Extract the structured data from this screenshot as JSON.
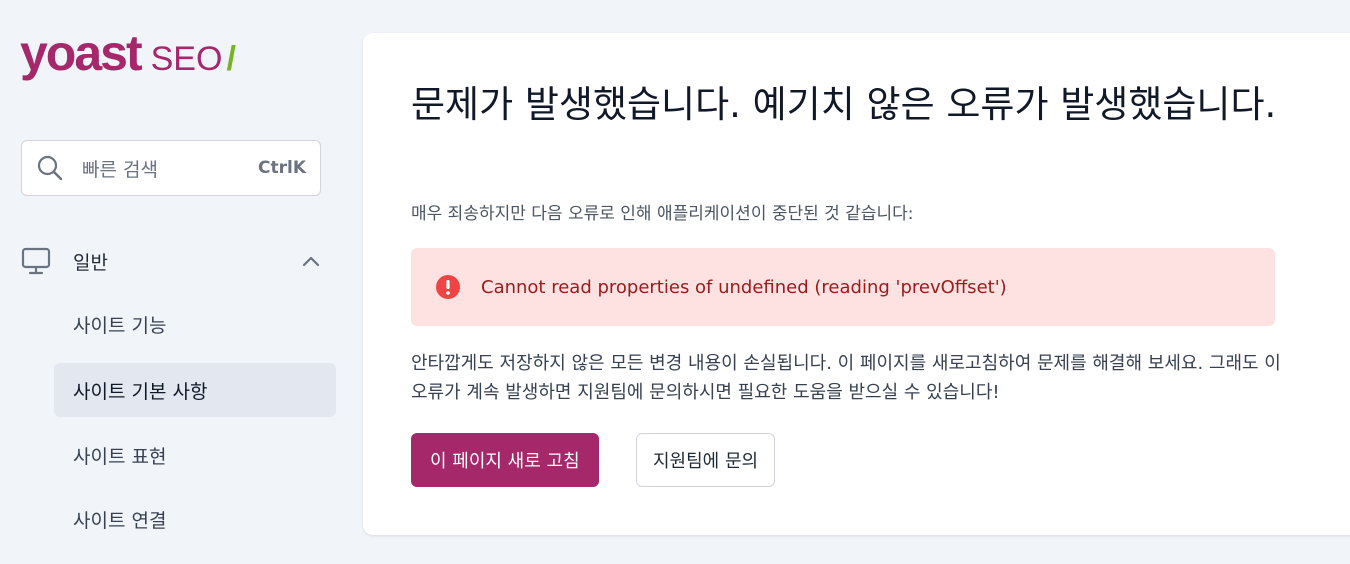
{
  "brand": {
    "word": "yoast",
    "product": "SEO",
    "slash": "/",
    "primary_color": "#a4286a",
    "accent_color": "#77b227"
  },
  "search": {
    "placeholder": "빠른 검색",
    "shortcut": "CtrlK",
    "icon": "search-icon"
  },
  "sidebar": {
    "group": {
      "label": "일반",
      "icon": "desktop-icon",
      "toggle_icon": "chevron-up-icon",
      "expanded": true
    },
    "items": [
      {
        "label": "사이트 기능",
        "active": false
      },
      {
        "label": "사이트 기본 사항",
        "active": true
      },
      {
        "label": "사이트 표현",
        "active": false
      },
      {
        "label": "사이트 연결",
        "active": false
      }
    ]
  },
  "main": {
    "title": "문제가 발생했습니다. 예기치 않은 오류가 발생했습니다.",
    "subtitle": "매우 죄송하지만 다음 오류로 인해 애플리케이션이 중단된 것 같습니다:",
    "error": {
      "icon": "exclamation-circle-icon",
      "message": "Cannot read properties of undefined (reading 'prevOffset')",
      "color": "#991b1b"
    },
    "body": "안타깝게도 저장하지 않은 모든 변경 내용이 손실됩니다. 이 페이지를 새로고침하여 문제를 해결해 보세요. 그래도 이 오류가 계속 발생하면 지원팀에 문의하시면 필요한 도움을 받으실 수 있습니다!",
    "buttons": {
      "reload": "이 페이지 새로 고침",
      "contact": "지원팀에 문의"
    }
  }
}
